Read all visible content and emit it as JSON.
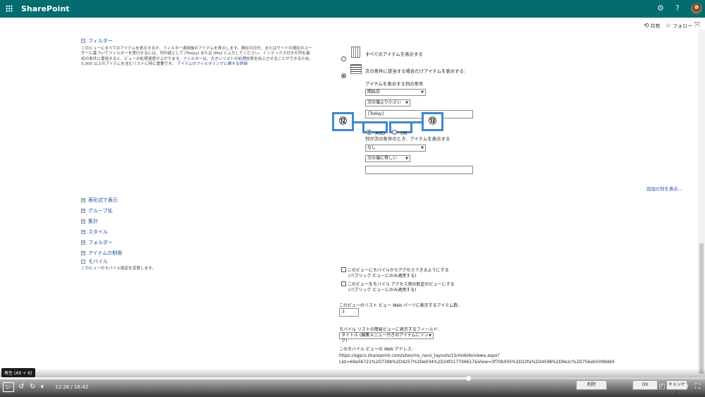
{
  "topbar": {
    "brand": "SharePoint",
    "settings_icon": "gear-icon",
    "help_label": "?"
  },
  "commands": {
    "share_label": "共有",
    "follow_label": "フォロー"
  },
  "filter_section": {
    "header": "フィルター",
    "description": "このビューにすべてのアイテムを表示するか、フィルター適用後のアイテムを表示します。現在の日付、またはサイトの現在のユーザーに基づいてフィルターを実行するには、列の値として [Today] または [Me] と入力してください。インデックス付きの列を最初の条件に使用すると、ビューの処理速度が上がります。フィルターは、大きいリストの処理効率を向上させることができるため、5,000 以上のアイテムを含むリストに特に重要です。",
    "link_text": "アイテムのフィルタリングに関する詳細"
  },
  "filter_options": {
    "show_all_label": "すべてのアイテムを表示する",
    "show_matching_label": "次の条件に該当する場合だけアイテムを表示する:",
    "condition_label": "アイテムを表示する列の条件",
    "column1_value": "開始日",
    "operator1_value": "次の値より小さい",
    "value1": "[Today]",
    "and_label": "AND",
    "or_label": "OR",
    "then_label": "列が次の条件のとき、アイテムを表示する",
    "column2_value": "なし",
    "operator2_value": "次の値に等しい",
    "value2": "",
    "more_columns_link": "追加の列を表示..."
  },
  "callouts": {
    "and_number": "⑫",
    "or_number": "⑬"
  },
  "collapsed_sections": [
    {
      "label": "表形式で表示"
    },
    {
      "label": "グループ化"
    },
    {
      "label": "集計"
    },
    {
      "label": "スタイル"
    },
    {
      "label": "フォルダー"
    },
    {
      "label": "アイテムの制限"
    },
    {
      "label": "モバイル"
    }
  ],
  "mobile": {
    "description": "このビューのモバイル設定を変更します。",
    "checkbox1_line1": "このビューにモバイルからアクセスできるようにする",
    "checkbox1_line2": "(パブリック ビューにのみ適用する)",
    "checkbox2_line1": "このビューをモバイル アクセス用の既定のビューにする",
    "checkbox2_line2": "(パブリック ビューにのみ適用する)",
    "item_count_label": "このビューのリスト ビュー Web パーツに表示するアイテム数:",
    "item_count_value": "3",
    "field_label": "モバイル リストの簡易ビューに表示するフィールド:",
    "field_value": "タイトル (編集メニュー付きのアイテムにリンク)",
    "address_label": "このモバイル ビューの Web アドレス:",
    "address_line1": "https://sgpcs.sharepoint.com/sites/ms_navi/_layouts/15/mobile/viewa.aspx?",
    "address_line2": "List=69a5b721%2D739b%2D4257%2De034%2D34f217706617&View=3f70b005%2D22fa%2D4598%2D9e2c%2D756eb5099dd4"
  },
  "dialog_buttons": {
    "delete_label": "削除",
    "ok_label": "OK",
    "cancel_label": "キャンセル"
  },
  "video": {
    "tooltip": "再生 (Alt + K)",
    "current_time": "12:26",
    "duration": "18:42",
    "timecode": "12:26 / 18:42",
    "progress_fraction": 0.664
  }
}
